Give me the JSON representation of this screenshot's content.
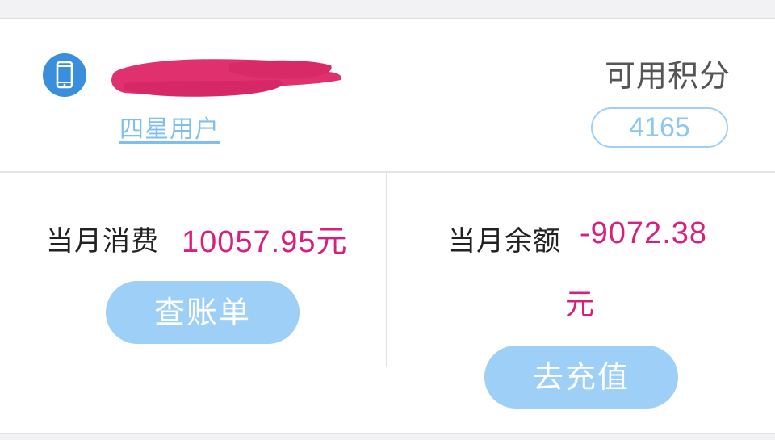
{
  "account": {
    "user_level": "四星用户"
  },
  "points": {
    "label": "可用积分",
    "value": "4165"
  },
  "monthly_spend": {
    "label": "当月消费",
    "value": "10057.95元",
    "button_label": "查账单"
  },
  "monthly_balance": {
    "label": "当月余额",
    "value": "-9072.38",
    "unit": "元",
    "button_label": "去充值"
  },
  "colors": {
    "accent_blue": "#9ed0f7",
    "icon_blue": "#3a8fdc",
    "value_magenta": "#d91e7c",
    "redaction": "#e0306e"
  },
  "icons": {
    "account_icon": "phone-icon"
  }
}
